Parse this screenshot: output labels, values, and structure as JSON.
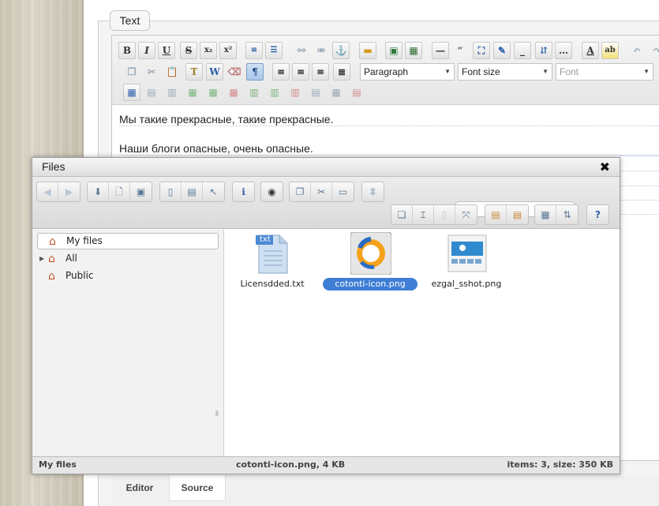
{
  "fieldset": {
    "legend": "Text"
  },
  "editor": {
    "toolbar": {
      "format_select": "Paragraph",
      "font_size_select": "Font size",
      "font_select": "Font"
    },
    "paragraphs": [
      "Мы такие прекрасные, такие прекрасные.",
      "Наши блоги опасные, очень опасные."
    ],
    "tabs": [
      "Editor",
      "Source"
    ]
  },
  "dialog": {
    "title": "Files",
    "search": {
      "value": "",
      "placeholder": ""
    },
    "tree": [
      {
        "label": "My files",
        "icon": "home-icon",
        "selected": true
      },
      {
        "label": "All",
        "icon": "home-icon",
        "expandable": true
      },
      {
        "label": "Public",
        "icon": "home-icon"
      }
    ],
    "files": [
      {
        "name": "Licensdded.txt",
        "icon": "text-file-icon",
        "badge": "txt"
      },
      {
        "name": "cotonti-icon.png",
        "icon": "image-file-icon",
        "selected": true
      },
      {
        "name": "ezgal_sshot.png",
        "icon": "image-file-icon"
      }
    ],
    "status": {
      "left": "My files",
      "middle": "cotonti-icon.png, 4 KB",
      "right": "items: 3, size: 350 KB"
    }
  },
  "colors": {
    "selection": "#3f7ed4",
    "toolbar_icon": "#5a7896",
    "accent_orange": "#f5a21b"
  }
}
